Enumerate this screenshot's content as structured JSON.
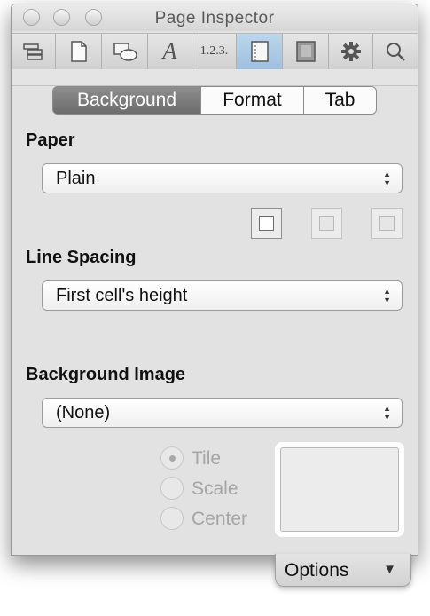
{
  "window": {
    "title": "Page Inspector"
  },
  "toolbar": {
    "tools": [
      {
        "icon": "document-structure-icon"
      },
      {
        "icon": "page-icon"
      },
      {
        "icon": "shapes-icon"
      },
      {
        "icon": "text-icon",
        "glyph": "A"
      },
      {
        "icon": "list-numbering-icon",
        "glyph": "1.2.3."
      },
      {
        "icon": "layout-icon",
        "active": true
      },
      {
        "icon": "graphic-icon"
      },
      {
        "icon": "gear-icon"
      },
      {
        "icon": "search-icon"
      }
    ]
  },
  "tabs": {
    "background": "Background",
    "format": "Format",
    "tab": "Tab",
    "selected": "Background"
  },
  "paper": {
    "label": "Paper",
    "value": "Plain"
  },
  "line_spacing": {
    "label": "Line Spacing",
    "value": "First cell's height"
  },
  "background_image": {
    "label": "Background Image",
    "value": "(None)",
    "options": [
      {
        "label": "Tile",
        "selected": true
      },
      {
        "label": "Scale",
        "selected": false
      },
      {
        "label": "Center",
        "selected": false
      }
    ]
  },
  "options_button": {
    "label": "Options"
  },
  "colors": {
    "accent": "#9ec0de",
    "selected_segment": "#7a7a7a"
  }
}
